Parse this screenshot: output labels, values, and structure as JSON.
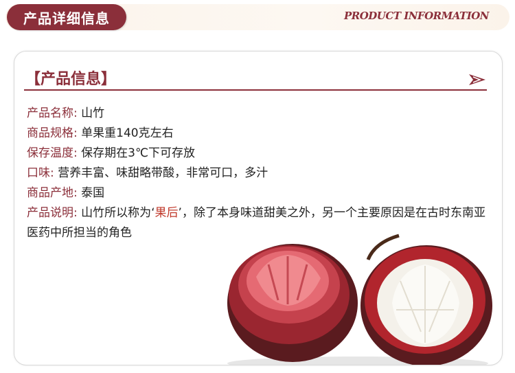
{
  "header": {
    "title": "产品详细信息",
    "subtitle_en": "PRODUCT INFORMATION"
  },
  "section": {
    "title": "【产品信息】"
  },
  "info": {
    "name_label": "产品名称:",
    "name_value": "山竹",
    "spec_label": "商品规格:",
    "spec_value": "单果重140克左右",
    "storage_label": "保存温度:",
    "storage_value": "保存期在3℃下可存放",
    "taste_label": "口味:",
    "taste_value": "营养丰富、味甜略带酸，非常可口，多汁",
    "origin_label": "商品产地:",
    "origin_value": "泰国",
    "desc_label": "产品说明:",
    "desc_prefix": "山竹所以称为‘",
    "desc_highlight": "果后",
    "desc_suffix": "’，除了本身味道甜美之外，另一个主要原因是在古时东南亚医药中所担当的角色"
  },
  "colors": {
    "accent": "#8b2f3a",
    "highlight": "#c0392b",
    "header_bg": "#fbf3ea"
  }
}
